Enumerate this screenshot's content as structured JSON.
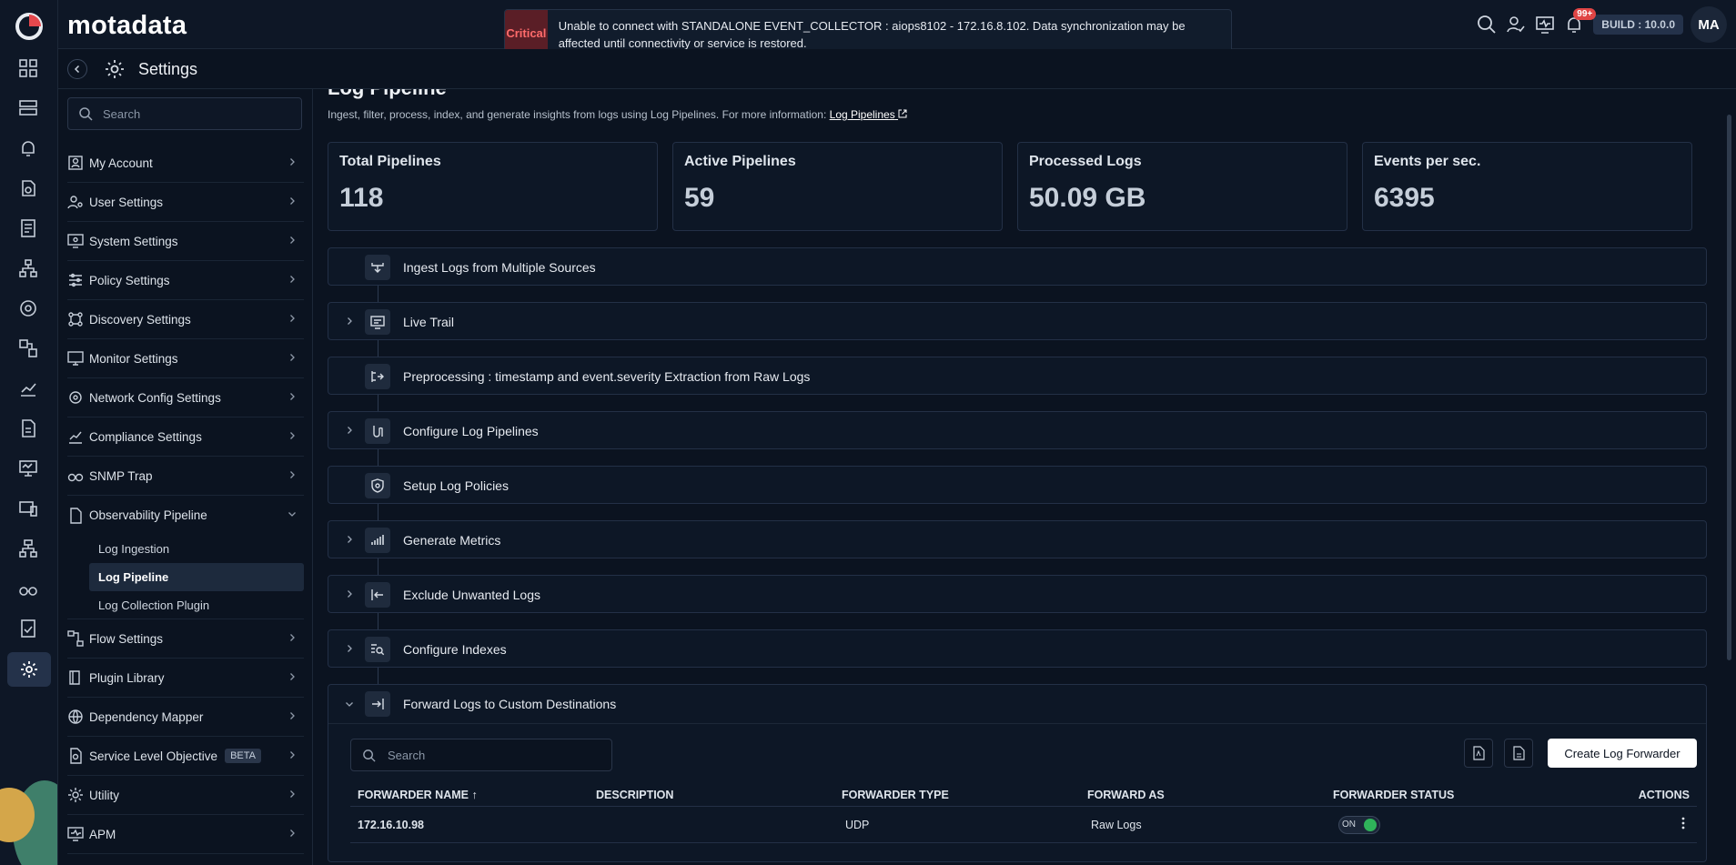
{
  "brand": "motadata",
  "alert": {
    "severity": "Critical",
    "message": "Unable to connect with STANDALONE EVENT_COLLECTOR : aiops8102 - 172.16.8.102. Data synchronization may be affected until connectivity or service is restored."
  },
  "topbar": {
    "notifications_count": "99+",
    "build": "BUILD : 10.0.0",
    "user_initials": "MA"
  },
  "page": {
    "section_title": "Settings"
  },
  "sidebar": {
    "search_placeholder": "Search",
    "items": [
      {
        "label": "My Account",
        "icon": "user-card-icon"
      },
      {
        "label": "User Settings",
        "icon": "user-gear-icon"
      },
      {
        "label": "System Settings",
        "icon": "monitor-gear-icon"
      },
      {
        "label": "Policy Settings",
        "icon": "sliders-icon"
      },
      {
        "label": "Discovery Settings",
        "icon": "discovery-icon"
      },
      {
        "label": "Monitor Settings",
        "icon": "monitor-icon"
      },
      {
        "label": "Network Config Settings",
        "icon": "network-gear-icon"
      },
      {
        "label": "Compliance Settings",
        "icon": "chart-line-icon"
      },
      {
        "label": "SNMP Trap",
        "icon": "binoculars-icon"
      },
      {
        "label": "Observability Pipeline",
        "icon": "document-icon"
      },
      {
        "label": "Flow Settings",
        "icon": "flow-icon"
      },
      {
        "label": "Plugin Library",
        "icon": "book-icon"
      },
      {
        "label": "Dependency Mapper",
        "icon": "globe-icon"
      },
      {
        "label": "Service Level Objective",
        "icon": "slo-icon",
        "badge": "BETA"
      },
      {
        "label": "Utility",
        "icon": "gear-icon"
      },
      {
        "label": "APM",
        "icon": "apm-icon"
      }
    ],
    "sub_items": [
      "Log Ingestion",
      "Log Pipeline",
      "Log Collection Plugin"
    ]
  },
  "main": {
    "title": "Log Pipeline",
    "description": "Ingest, filter, process, index, and generate insights from logs using Log Pipelines. For more information:",
    "link_text": "Log Pipelines",
    "stats": [
      {
        "label": "Total Pipelines",
        "value": "118"
      },
      {
        "label": "Active Pipelines",
        "value": "59"
      },
      {
        "label": "Processed Logs",
        "value": "50.09 GB"
      },
      {
        "label": "Events per sec.",
        "value": "6395"
      }
    ],
    "steps": [
      "Ingest Logs from Multiple Sources",
      "Live Trail",
      "Preprocessing : timestamp and event.severity Extraction from Raw Logs",
      "Configure Log Pipelines",
      "Setup Log Policies",
      "Generate Metrics",
      "Exclude Unwanted Logs",
      "Configure Indexes",
      "Forward Logs to Custom Destinations"
    ],
    "forwarder": {
      "search_placeholder": "Search",
      "create_label": "Create Log Forwarder",
      "columns": [
        "FORWARDER NAME ↑",
        "DESCRIPTION",
        "FORWARDER TYPE",
        "FORWARD AS",
        "FORWARDER STATUS",
        "ACTIONS"
      ],
      "rows": [
        {
          "name": "172.16.10.98",
          "description": "",
          "type": "UDP",
          "forward_as": "Raw Logs",
          "status": "ON"
        }
      ]
    }
  }
}
